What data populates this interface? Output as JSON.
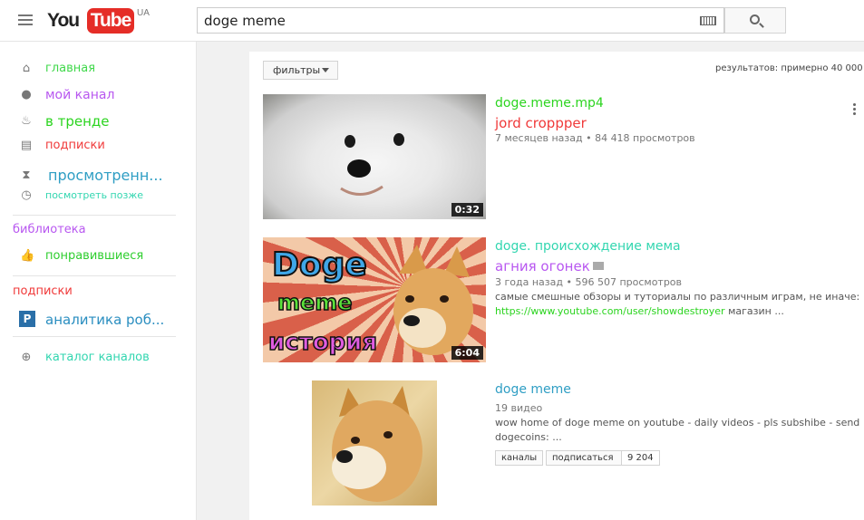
{
  "header": {
    "logo_you": "You",
    "logo_tube": "Tube",
    "region": "UA",
    "search_value": "doge meme"
  },
  "sidebar": {
    "items": [
      {
        "label": "главная",
        "color": "#3fd84a",
        "icon": "home-icon"
      },
      {
        "label": "мой канал",
        "color": "#b857f0",
        "icon": "account-icon"
      },
      {
        "label": "в тренде",
        "color": "#2bd41f",
        "icon": "flame-icon"
      },
      {
        "label": "подписки",
        "color": "#f03a3a",
        "icon": "subscriptions-icon"
      },
      {
        "label": "просмотренн...",
        "color": "#2f9ec4",
        "icon": "hourglass-icon"
      },
      {
        "label": "посмотреть позже",
        "color": "#32d6b0",
        "icon": "clock-icon"
      }
    ],
    "library_title": "библиотека",
    "library_items": [
      {
        "label": "понравившиеся",
        "color": "#2ece2e",
        "icon": "thumbs-up-icon"
      }
    ],
    "subs_title": "подписки",
    "subs_items": [
      {
        "label": "аналитика роб...",
        "color": "#2a8ec0",
        "icon": "channel-avatar-icon"
      }
    ],
    "catalog_label": "каталог каналов"
  },
  "main": {
    "filter_label": "фильтры",
    "results": "результатов: примерно 40 000",
    "videos": [
      {
        "title": "doge.meme.mp4",
        "channel": "jord croppper",
        "meta": "7 месяцев назад • 84 418 просмотров",
        "duration": "0:32"
      },
      {
        "title": "doge. происхождение мема",
        "channel": "агния огонек",
        "meta": "3 года назад • 596 507 просмотров",
        "desc1": "самые смешные обзоры и туториалы по различным играм, не иначе:",
        "desc_link": "https://www.youtube.com/user/showdestroyer",
        "desc2": " магазин ...",
        "duration": "6:04",
        "thumb_text_1": "Doge",
        "thumb_text_2": "meme",
        "thumb_text_3": "история"
      }
    ],
    "channel": {
      "title": "doge meme",
      "videos_count": "19 видео",
      "desc1": "wow home of doge meme on youtube - daily videos - pls subshibe - send",
      "desc2": "dogecoins: ...",
      "tag": "каналы",
      "subscribe": "подписаться",
      "subs_count": "9 204"
    }
  }
}
